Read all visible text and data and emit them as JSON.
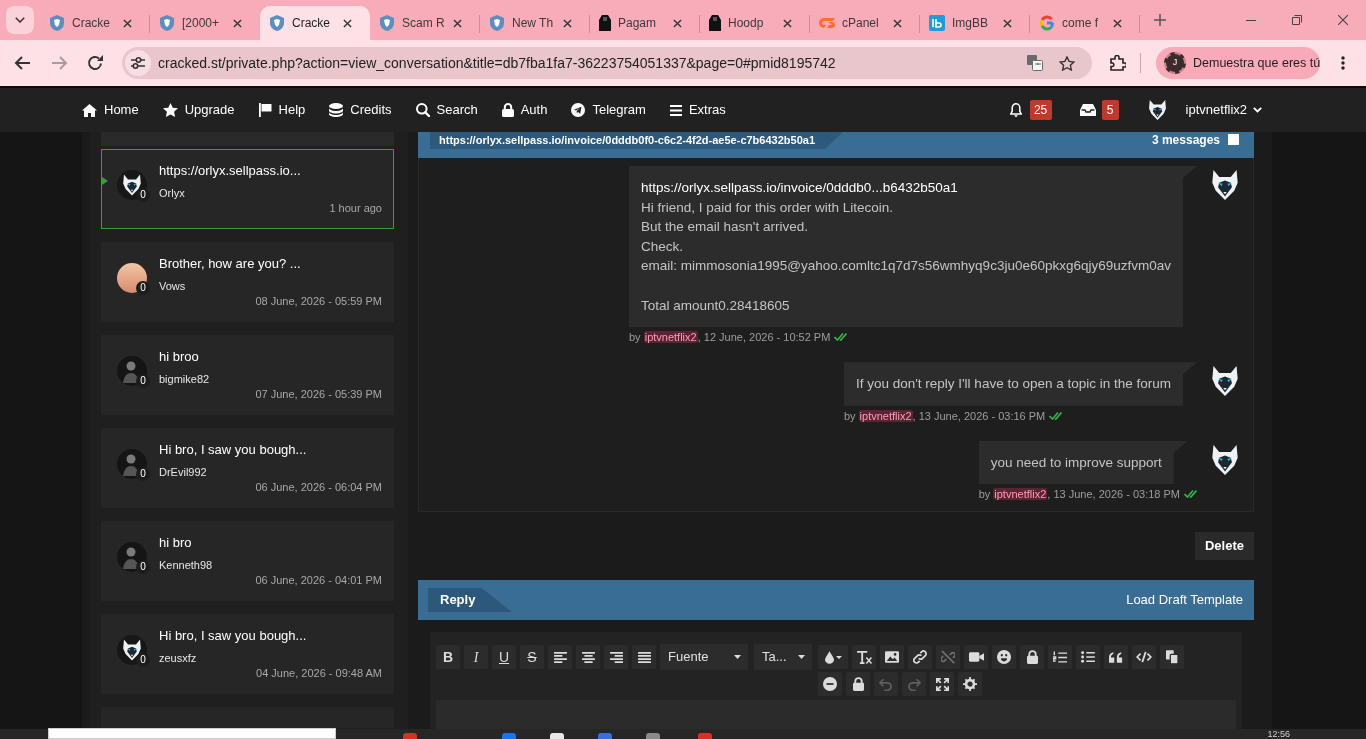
{
  "browser": {
    "tabs": [
      {
        "title": "Cracke",
        "selected": false
      },
      {
        "title": "[2000+",
        "selected": false
      },
      {
        "title": "Cracke",
        "selected": true
      },
      {
        "title": "Scam R",
        "selected": false
      },
      {
        "title": "New Th",
        "selected": false
      },
      {
        "title": "Pagam",
        "selected": false
      },
      {
        "title": "Hoodp",
        "selected": false
      },
      {
        "title": "cPanel",
        "selected": false
      },
      {
        "title": "ImgBB",
        "selected": false
      },
      {
        "title": "come f",
        "selected": false
      }
    ],
    "forward": {
      "disabled": true
    },
    "url": "cracked.st/private.php?action=view_conversation&title=db7fba1fa7-36223754051337&page=0#pmid8195742",
    "profile": {
      "initial": "J",
      "label": "Demuestra que eres tú"
    }
  },
  "nav": {
    "items": [
      {
        "label": "Home"
      },
      {
        "label": "Upgrade"
      },
      {
        "label": "Help"
      },
      {
        "label": "Credits"
      },
      {
        "label": "Search"
      },
      {
        "label": "Auth"
      },
      {
        "label": "Telegram"
      },
      {
        "label": "Extras"
      }
    ],
    "notifications": "25",
    "inbox": "5",
    "username": "iptvnetflix2"
  },
  "sidebar": {
    "conversations": [
      {
        "title": "https://orlyx.sellpass.io...",
        "user": "Orlyx",
        "time": "1 hour ago",
        "badge": "0",
        "avatar": {
          "kind": "wolf"
        },
        "selected": true
      },
      {
        "title": "Brother, how are you? ...",
        "user": "Vows",
        "time": "08 June, 2026 - 05:59 PM",
        "badge": "0",
        "avatar": {
          "kind": "photo"
        },
        "selected": false
      },
      {
        "title": "hi broo",
        "user": "bigmike82",
        "time": "07 June, 2026 - 05:39 PM",
        "badge": "0",
        "avatar": {
          "kind": "silhouette"
        },
        "selected": false
      },
      {
        "title": "Hi bro, I saw you bough...",
        "user": "DrEvil992",
        "time": "06 June, 2026 - 06:04 PM",
        "badge": "0",
        "avatar": {
          "kind": "silhouette"
        },
        "selected": false
      },
      {
        "title": "hi bro",
        "user": "Kenneth98",
        "time": "06 June, 2026 - 04:01 PM",
        "badge": "0",
        "avatar": {
          "kind": "silhouette"
        },
        "selected": false
      },
      {
        "title": "Hi bro, I saw you bough...",
        "user": "zeusxfz",
        "time": "04 June, 2026 - 09:48 AM",
        "badge": "0",
        "avatar": {
          "kind": "wolf"
        },
        "selected": false
      }
    ],
    "more_below": true
  },
  "conversation": {
    "title": "https://orlyx.sellpass.io/invoice/0dddb0f0-c6c2-4f2d-ae5e-c7b6432b50a1",
    "count": "3 messages",
    "select_all": {
      "checked": false
    },
    "messages": [
      {
        "link": "https://orlyx.sellpass.io/invoice/0dddb0...b6432b50a1",
        "paragraphs": [
          [
            "Hi friend, I paid for this order with Litecoin.",
            "But the email hasn't arrived.",
            "Check.",
            "email: mimmosonia1995@yahoo.comltc1q7d7s56wmhyq9c3ju0e60pkxg6qjy69uzfvm0av"
          ],
          [
            "Total amount0.28418605"
          ]
        ],
        "prefix": "by",
        "author": "iptvnetflix2",
        "suffix": ", 12 June, 2026 - 10:52 PM",
        "read": true
      },
      {
        "paragraphs": [
          [
            "If you don't reply I'll have to open a topic in the forum"
          ]
        ],
        "prefix": "by",
        "author": "iptvnetflix2",
        "suffix": ", 13 June, 2026 - 03:16 PM",
        "read": true
      },
      {
        "paragraphs": [
          [
            "you need to improve support"
          ]
        ],
        "prefix": "by",
        "author": "iptvnetflix2",
        "suffix": ", 13 June, 2026 - 03:18 PM",
        "read": true
      }
    ],
    "delete_label": "Delete"
  },
  "reply": {
    "tab": "Reply",
    "draft": "Load Draft Template",
    "format_buttons": [
      {
        "label": "B"
      },
      {
        "label": "I"
      },
      {
        "label": "U"
      },
      {
        "label": "S"
      }
    ],
    "font": "Fuente",
    "size": "Ta...",
    "unlink": {
      "disabled": true
    },
    "undo": {
      "disabled": true
    },
    "redo": {
      "disabled": true
    }
  },
  "taskbar": {
    "clock": "12:56"
  }
}
